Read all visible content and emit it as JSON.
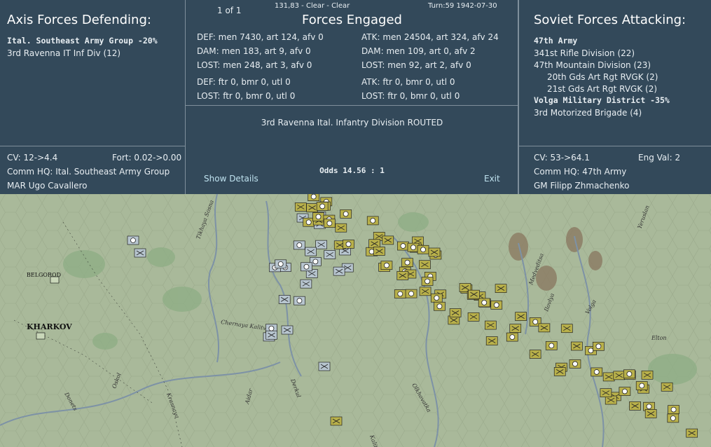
{
  "header": {
    "page_indicator": "1 of 1",
    "coords_weather": "131,83 - Clear - Clear",
    "turn_date": "Turn:59  1942-07-30"
  },
  "defender": {
    "title": "Axis Forces Defending:",
    "units": [
      {
        "text": "Ital. Southeast Army Group  -20%",
        "bold": true
      },
      {
        "text": "3rd Ravenna IT Inf Div (12)",
        "bold": false
      }
    ],
    "cv": "CV: 12->4.4",
    "fort": "Fort: 0.02->0.00",
    "comm_hq": "Comm HQ: Ital. Southeast Army Group",
    "commander": "MAR Ugo Cavallero"
  },
  "engaged": {
    "title": "Forces Engaged",
    "def": [
      "DEF: men 7430, art 124, afv 0",
      "DAM: men 183, art 9, afv 0",
      "LOST: men 248, art 3, afv 0"
    ],
    "def_air": [
      "DEF: ftr 0, bmr 0, utl 0",
      "LOST: ftr 0, bmr 0, utl 0"
    ],
    "atk": [
      "ATK: men 24504, art 324, afv 24",
      "DAM: men 109, art 0, afv 2",
      "LOST: men 92, art 2, afv 0"
    ],
    "atk_air": [
      "ATK: ftr 0, bmr 0, utl 0",
      "LOST: ftr 0, bmr 0, utl 0"
    ],
    "result": "3rd Ravenna Ital. Infantry Division ROUTED",
    "odds": "Odds 14.56 : 1",
    "show_details": "Show Details",
    "exit": "Exit"
  },
  "attacker": {
    "title": "Soviet Forces Attacking:",
    "units": [
      {
        "text": "47th Army",
        "bold": true,
        "indent": false
      },
      {
        "text": "341st Rifle Division (22)",
        "bold": false,
        "indent": false
      },
      {
        "text": "47th Mountain Division (23)",
        "bold": false,
        "indent": false
      },
      {
        "text": "20th Gds Art Rgt RVGK (2)",
        "bold": false,
        "indent": true
      },
      {
        "text": "21st Gds Art Rgt RVGK (2)",
        "bold": false,
        "indent": true
      },
      {
        "text": "Volga Military District  -35%",
        "bold": true,
        "indent": false
      },
      {
        "text": "3rd Motorized Brigade (4)",
        "bold": false,
        "indent": false
      }
    ],
    "cv": "CV: 53->64.1",
    "eng_val": "Eng Val: 2",
    "comm_hq": "Comm HQ: 47th Army",
    "commander": "GM Filipp Zhmachenko"
  },
  "map": {
    "cities": [
      "BELGOROD",
      "KHARKOV"
    ],
    "rivers": [
      "Tikhaya Sosna",
      "Chernaya Kalitva",
      "Oskol",
      "Donets",
      "Aidar",
      "Derkul",
      "Krasnaya",
      "Kalitva",
      "Olkhovatka",
      "Medveditsa",
      "Ilovlya",
      "Volga",
      "Elton",
      "Yeruslan"
    ],
    "colors": {
      "map_bg": "#a9b99a",
      "panel_bg": "#33495a",
      "axis_unit": "#b7c5cf",
      "soviet_unit": "#b8b04a",
      "link": "#bfe2ef"
    }
  }
}
